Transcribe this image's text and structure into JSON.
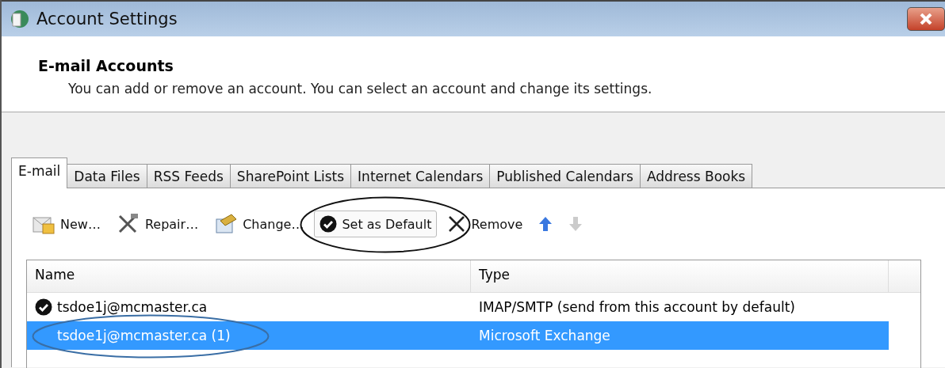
{
  "window": {
    "title": "Account Settings"
  },
  "header": {
    "title": "E-mail Accounts",
    "description": "You can add or remove an account. You can select an account and change its settings."
  },
  "tabs": [
    {
      "label": "E-mail",
      "selected": true
    },
    {
      "label": "Data Files",
      "selected": false
    },
    {
      "label": "RSS Feeds",
      "selected": false
    },
    {
      "label": "SharePoint Lists",
      "selected": false
    },
    {
      "label": "Internet Calendars",
      "selected": false
    },
    {
      "label": "Published Calendars",
      "selected": false
    },
    {
      "label": "Address Books",
      "selected": false
    }
  ],
  "toolbar": [
    {
      "kind": "new",
      "label": "New…",
      "disabled": false,
      "circled": false
    },
    {
      "kind": "repair",
      "label": "Repair…",
      "disabled": false,
      "circled": false
    },
    {
      "kind": "change",
      "label": "Change…",
      "disabled": false,
      "circled": false
    },
    {
      "kind": "default",
      "label": "Set as Default",
      "disabled": false,
      "circled": true
    },
    {
      "kind": "remove",
      "label": "Remove",
      "disabled": false,
      "circled": false
    },
    {
      "kind": "up",
      "disabled": false,
      "circled": false
    },
    {
      "kind": "down",
      "disabled": true,
      "circled": false
    }
  ],
  "table": {
    "columns": [
      "Name",
      "Type"
    ],
    "rows": [
      {
        "name": "tsdoe1j@mcmaster.ca",
        "type": "IMAP/SMTP (send from this account by default)",
        "default": true,
        "selected": false,
        "circled": false
      },
      {
        "name": "tsdoe1j@mcmaster.ca (1)",
        "type": "Microsoft Exchange",
        "default": false,
        "selected": true,
        "circled": true
      }
    ]
  }
}
